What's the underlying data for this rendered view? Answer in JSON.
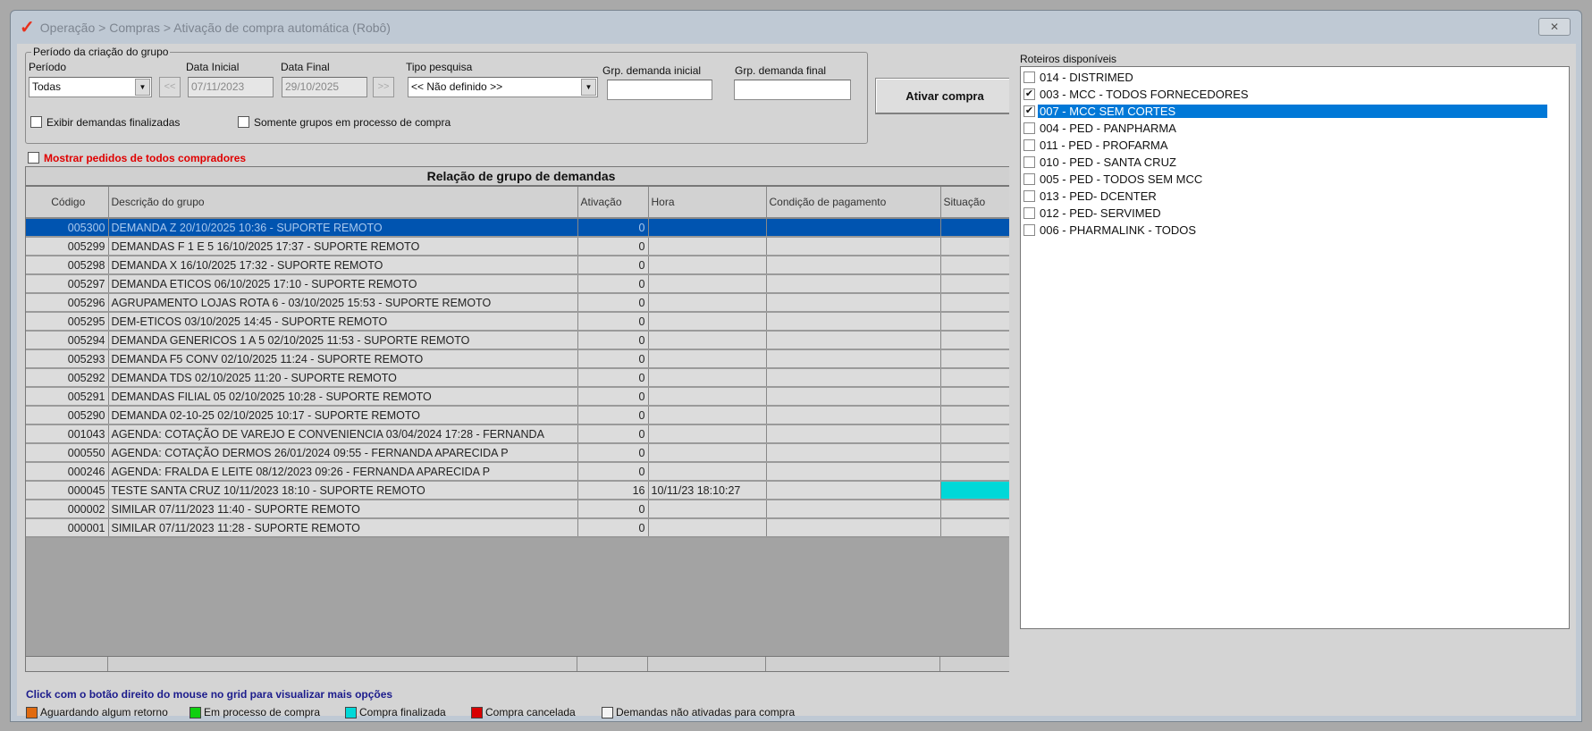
{
  "window": {
    "title": "Operação > Compras > Ativação de compra automática (Robô)",
    "close": "✕"
  },
  "filters": {
    "group_title": "Período da criação do grupo",
    "periodo_label": "Período",
    "periodo_value": "Todas",
    "data_inicial_label": "Data Inicial",
    "data_inicial_value": "07/11/2023",
    "data_final_label": "Data Final",
    "data_final_value": "29/10/2025",
    "prev": "<<",
    "next": ">>",
    "tipo_label": "Tipo pesquisa",
    "tipo_value": "<< Não definido >>",
    "grp_inicial_label": "Grp. demanda inicial",
    "grp_final_label": "Grp. demanda final",
    "exibir_label": "Exibir demandas finalizadas",
    "somente_label": "Somente grupos em processo de compra",
    "mostrar_label": "Mostrar pedidos de todos compradores"
  },
  "ativar_label": "Ativar compra",
  "grid": {
    "caption": "Relação de grupo de demandas",
    "columns": [
      "Código",
      "Descrição do grupo",
      "Ativação",
      "Hora",
      "Condição de pagamento",
      "Situação"
    ],
    "rows": [
      {
        "codigo": "005300",
        "desc": "DEMANDA Z 20/10/2025 10:36 - SUPORTE REMOTO",
        "ativ": "0",
        "hora": "",
        "sel": true
      },
      {
        "codigo": "005299",
        "desc": "DEMANDAS F 1 E 5 16/10/2025 17:37 - SUPORTE REMOTO",
        "ativ": "0",
        "hora": ""
      },
      {
        "codigo": "005298",
        "desc": "DEMANDA X 16/10/2025 17:32 - SUPORTE REMOTO",
        "ativ": "0",
        "hora": ""
      },
      {
        "codigo": "005297",
        "desc": "DEMANDA ETICOS 06/10/2025 17:10 - SUPORTE REMOTO",
        "ativ": "0",
        "hora": ""
      },
      {
        "codigo": "005296",
        "desc": "AGRUPAMENTO LOJAS ROTA 6 - 03/10/2025 15:53 - SUPORTE REMOTO",
        "ativ": "0",
        "hora": ""
      },
      {
        "codigo": "005295",
        "desc": "DEM-ETICOS 03/10/2025 14:45 - SUPORTE REMOTO",
        "ativ": "0",
        "hora": ""
      },
      {
        "codigo": "005294",
        "desc": "DEMANDA GENERICOS 1 A 5 02/10/2025 11:53 - SUPORTE REMOTO",
        "ativ": "0",
        "hora": ""
      },
      {
        "codigo": "005293",
        "desc": "DEMANDA F5 CONV 02/10/2025 11:24 - SUPORTE REMOTO",
        "ativ": "0",
        "hora": ""
      },
      {
        "codigo": "005292",
        "desc": "DEMANDA TDS 02/10/2025 11:20 - SUPORTE REMOTO",
        "ativ": "0",
        "hora": ""
      },
      {
        "codigo": "005291",
        "desc": "DEMANDAS FILIAL 05 02/10/2025 10:28 - SUPORTE REMOTO",
        "ativ": "0",
        "hora": ""
      },
      {
        "codigo": "005290",
        "desc": "DEMANDA 02-10-25 02/10/2025 10:17 - SUPORTE REMOTO",
        "ativ": "0",
        "hora": ""
      },
      {
        "codigo": "001043",
        "desc": "AGENDA: COTAÇÃO DE VAREJO E CONVENIENCIA 03/04/2024 17:28 - FERNANDA",
        "ativ": "0",
        "hora": ""
      },
      {
        "codigo": "000550",
        "desc": "AGENDA: COTAÇÃO DERMOS 26/01/2024 09:55 - FERNANDA APARECIDA P",
        "ativ": "0",
        "hora": ""
      },
      {
        "codigo": "000246",
        "desc": "AGENDA: FRALDA E LEITE 08/12/2023 09:26 - FERNANDA APARECIDA P",
        "ativ": "0",
        "hora": ""
      },
      {
        "codigo": "000045",
        "desc": "TESTE SANTA CRUZ 10/11/2023 18:10 - SUPORTE REMOTO",
        "ativ": "16",
        "hora": "10/11/23 18:10:27",
        "status": "finalizada"
      },
      {
        "codigo": "000002",
        "desc": "SIMILAR 07/11/2023 11:40 - SUPORTE REMOTO",
        "ativ": "0",
        "hora": ""
      },
      {
        "codigo": "000001",
        "desc": "SIMILAR 07/11/2023 11:28 - SUPORTE REMOTO",
        "ativ": "0",
        "hora": ""
      }
    ]
  },
  "hint": "Click com o botão direito do mouse no grid para visualizar mais opções",
  "legend": [
    {
      "label": "Aguardando algum retorno",
      "color": "#e06a10"
    },
    {
      "label": "Em processo de compra",
      "color": "#10d010"
    },
    {
      "label": "Compra finalizada",
      "color": "#00d8d8"
    },
    {
      "label": "Compra cancelada",
      "color": "#d80000"
    },
    {
      "label": "Demandas não ativadas para compra",
      "color": "#f4f4f4"
    }
  ],
  "roteiros": {
    "label": "Roteiros disponíveis",
    "items": [
      {
        "label": "014 - DISTRIMED",
        "checked": false
      },
      {
        "label": "003 - MCC - TODOS FORNECEDORES",
        "checked": true
      },
      {
        "label": "007 - MCC SEM CORTES",
        "checked": true,
        "selected": true
      },
      {
        "label": "004 - PED - PANPHARMA",
        "checked": false
      },
      {
        "label": "011 - PED - PROFARMA",
        "checked": false
      },
      {
        "label": "010 - PED - SANTA CRUZ",
        "checked": false
      },
      {
        "label": "005 - PED - TODOS SEM MCC",
        "checked": false
      },
      {
        "label": "013 - PED- DCENTER",
        "checked": false
      },
      {
        "label": "012 - PED- SERVIMED",
        "checked": false
      },
      {
        "label": "006 - PHARMALINK - TODOS",
        "checked": false
      }
    ]
  }
}
